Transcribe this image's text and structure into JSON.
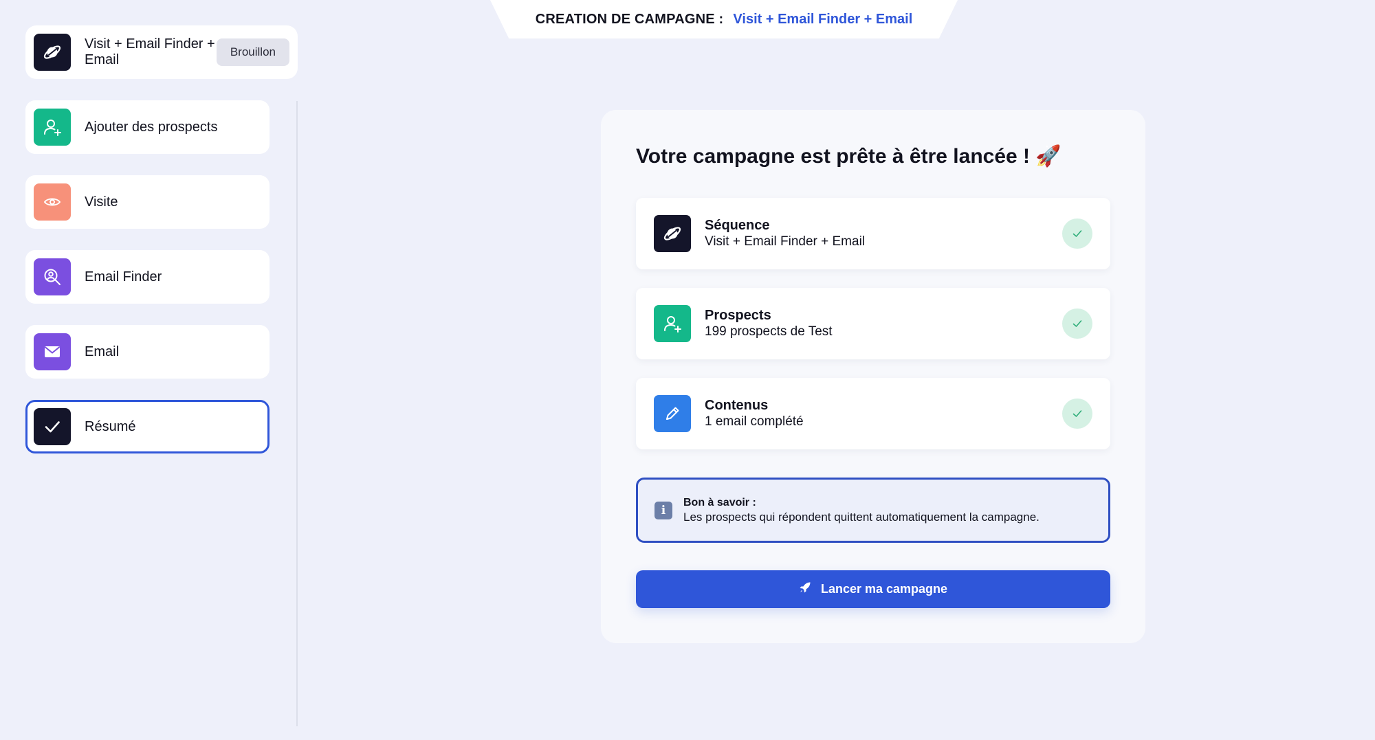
{
  "header": {
    "label": "CREATION DE CAMPAGNE :",
    "campaign_name": "Visit + Email Finder + Email"
  },
  "sidebar": {
    "campaign": {
      "title": "Visit + Email Finder + Email",
      "status": "Brouillon",
      "icon": "planet-icon",
      "color": "#14152a"
    },
    "items": [
      {
        "label": "Ajouter des prospects",
        "icon": "add-user-icon",
        "color": "#14b88a"
      },
      {
        "label": "Visite",
        "icon": "eye-icon",
        "color": "#f7917a"
      },
      {
        "label": "Email Finder",
        "icon": "search-user-icon",
        "color": "#7b4fe0"
      },
      {
        "label": "Email",
        "icon": "envelope-icon",
        "color": "#7b4fe0"
      },
      {
        "label": "Résumé",
        "icon": "check-icon",
        "color": "#14152a",
        "active": true
      }
    ]
  },
  "main": {
    "title": "Votre campagne est prête à être lancée ! 🚀",
    "summary": [
      {
        "title": "Séquence",
        "subtitle": "Visit + Email Finder + Email",
        "icon": "planet-icon",
        "color": "#14152a",
        "status": "complete"
      },
      {
        "title": "Prospects",
        "subtitle": "199 prospects de Test",
        "icon": "add-user-icon",
        "color": "#14b88a",
        "status": "complete"
      },
      {
        "title": "Contenus",
        "subtitle": "1 email complété",
        "icon": "pencil-icon",
        "color": "#2f7ee8",
        "status": "complete"
      }
    ],
    "info": {
      "icon": "info-icon",
      "title": "Bon à savoir :",
      "body": "Les prospects qui répondent quittent automatiquement la campagne."
    },
    "launch_button": {
      "label": "Lancer ma campagne",
      "icon": "rocket-icon",
      "color": "#2f56d9"
    }
  },
  "colors": {
    "accent": "#2f56d9",
    "background": "#eef0fa",
    "success": "#d5f1e4"
  }
}
